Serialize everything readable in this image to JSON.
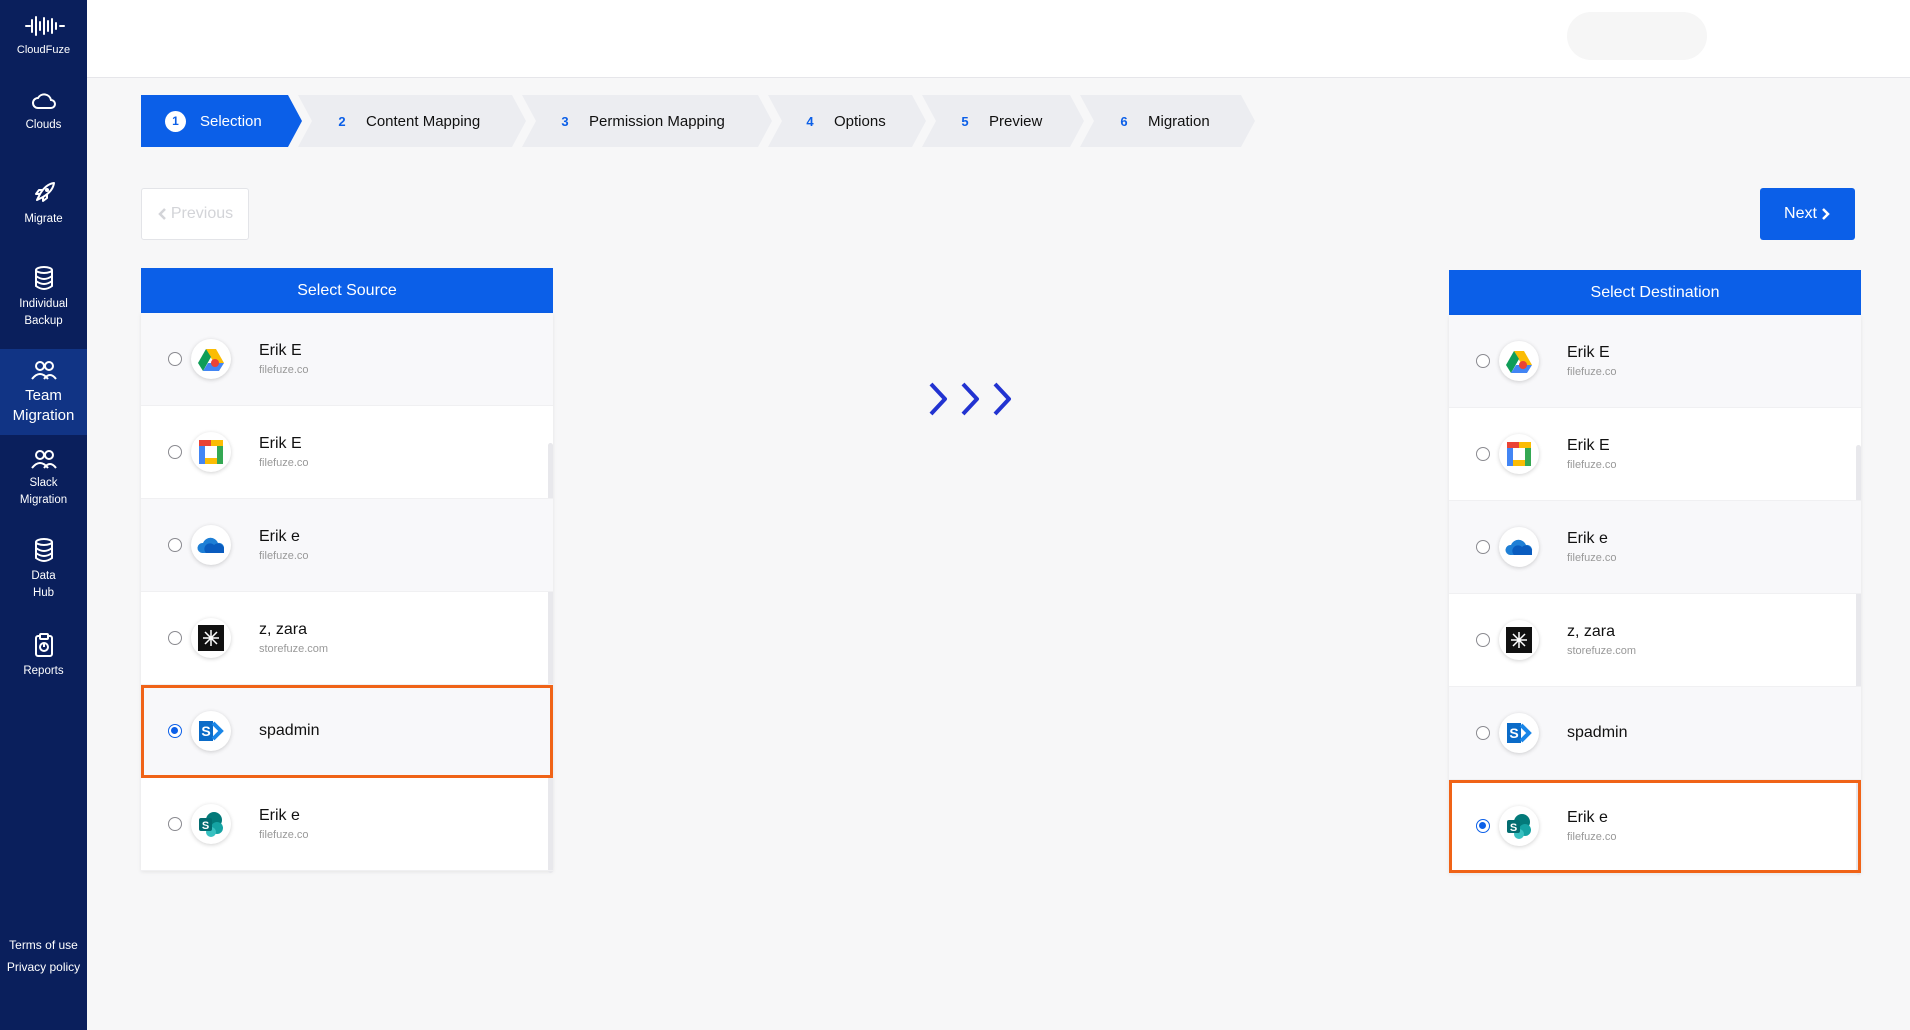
{
  "sidebar": {
    "brand": "CloudFuze",
    "items": [
      {
        "label": "Clouds",
        "icon": "cloud-icon"
      },
      {
        "label": "Migrate",
        "icon": "rocket-icon"
      },
      {
        "label": "Individual Backup",
        "icon": "database-icon"
      },
      {
        "label": "Team Migration",
        "icon": "users-icon",
        "active": true
      },
      {
        "label": "Slack Migration",
        "icon": "users-icon"
      },
      {
        "label": "Data Hub",
        "icon": "database-icon"
      },
      {
        "label": "Reports",
        "icon": "clipboard-icon"
      }
    ],
    "footer": {
      "terms": "Terms of use",
      "privacy": "Privacy policy"
    }
  },
  "steps": [
    {
      "num": "1",
      "label": "Selection"
    },
    {
      "num": "2",
      "label": "Content Mapping"
    },
    {
      "num": "3",
      "label": "Permission Mapping"
    },
    {
      "num": "4",
      "label": "Options"
    },
    {
      "num": "5",
      "label": "Preview"
    },
    {
      "num": "6",
      "label": "Migration"
    }
  ],
  "buttons": {
    "previous": "Previous",
    "next": "Next"
  },
  "source": {
    "title": "Select Source",
    "items": [
      {
        "name": "Erik E",
        "domain": "filefuze.co",
        "icon": "google-drive-icon"
      },
      {
        "name": "Erik E",
        "domain": "filefuze.co",
        "icon": "google-workspace-icon"
      },
      {
        "name": "Erik e",
        "domain": "filefuze.co",
        "icon": "onedrive-icon"
      },
      {
        "name": "z, zara",
        "domain": "storefuze.com",
        "icon": "box-black-icon"
      },
      {
        "name": "spadmin",
        "domain": "",
        "icon": "sharepoint-server-icon",
        "selected": true
      },
      {
        "name": "Erik e",
        "domain": "filefuze.co",
        "icon": "sharepoint-online-icon"
      }
    ]
  },
  "destination": {
    "title": "Select Destination",
    "items": [
      {
        "name": "Erik E",
        "domain": "filefuze.co",
        "icon": "google-drive-icon"
      },
      {
        "name": "Erik E",
        "domain": "filefuze.co",
        "icon": "google-workspace-icon"
      },
      {
        "name": "Erik e",
        "domain": "filefuze.co",
        "icon": "onedrive-icon"
      },
      {
        "name": "z, zara",
        "domain": "storefuze.com",
        "icon": "box-black-icon"
      },
      {
        "name": "spadmin",
        "domain": "",
        "icon": "sharepoint-server-icon"
      },
      {
        "name": "Erik e",
        "domain": "filefuze.co",
        "icon": "sharepoint-online-icon",
        "selected": true
      }
    ]
  },
  "colors": {
    "primary": "#0b5fe8",
    "sidebar": "#0a1f5c",
    "highlight": "#f06317",
    "arrows": "#2233d1"
  }
}
